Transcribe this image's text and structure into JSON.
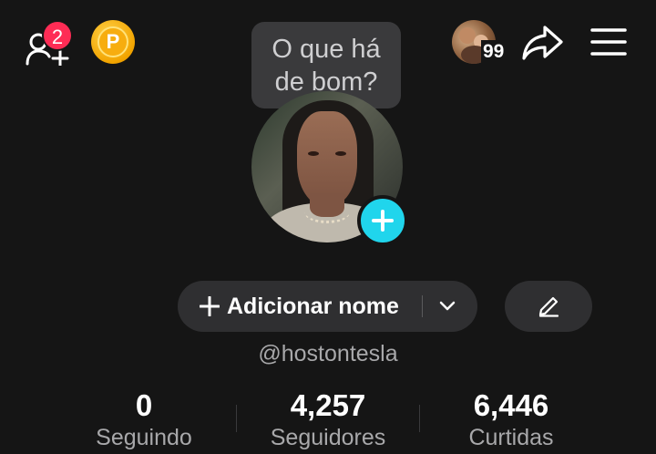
{
  "header": {
    "friend_requests_badge": "2",
    "coin_letter": "P",
    "stories_count": "99"
  },
  "bubble": {
    "line1": "O que há",
    "line2": "de bom?"
  },
  "profile": {
    "add_name_label": "Adicionar nome",
    "username": "@hostontesla"
  },
  "stats": [
    {
      "value": "0",
      "label": "Seguindo"
    },
    {
      "value": "4,257",
      "label": "Seguidores"
    },
    {
      "value": "6,446",
      "label": "Curtidas"
    }
  ],
  "colors": {
    "background": "#151515",
    "badge": "#fe2c55",
    "add_photo": "#20d5ec",
    "coin": "#f7ad0f",
    "button_bg": "#2f2f31"
  },
  "icons": [
    "add-friend-icon",
    "coin-icon",
    "share-icon",
    "menu-icon",
    "plus-icon",
    "chevron-down-icon",
    "pencil-icon"
  ]
}
